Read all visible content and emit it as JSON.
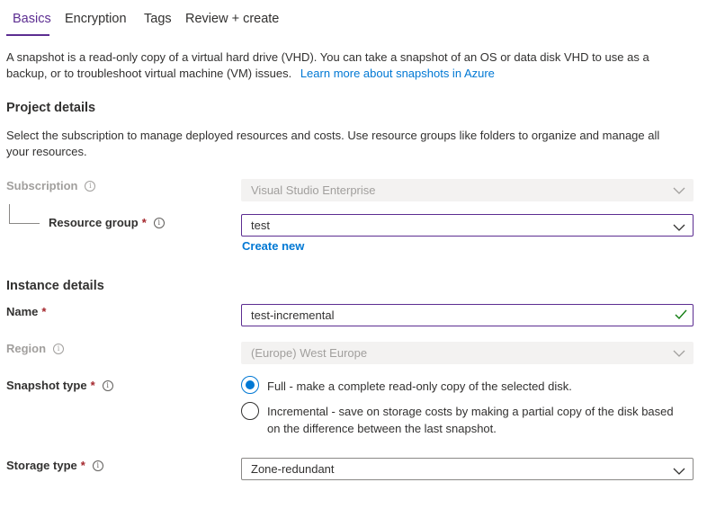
{
  "tabs": [
    {
      "label": "Basics",
      "active": true
    },
    {
      "label": "Encryption",
      "active": false
    },
    {
      "label": "Tags",
      "active": false
    },
    {
      "label": "Review + create",
      "active": false
    }
  ],
  "intro": {
    "line1": "A snapshot is a read-only copy of a virtual hard drive (VHD). You can take a snapshot of an OS or data disk VHD to use as a",
    "line2": "backup, or to troubleshoot virtual machine (VM) issues.",
    "link": "Learn more about snapshots in Azure"
  },
  "project_details": {
    "title": "Project details",
    "desc_line1": "Select the subscription to manage deployed resources and costs. Use resource groups like folders to organize and manage all",
    "desc_line2": "your resources.",
    "subscription": {
      "label": "Subscription",
      "value": "Visual Studio Enterprise",
      "disabled": true
    },
    "resource_group": {
      "label": "Resource group",
      "required_mark": "*",
      "value": "test",
      "create_new": "Create new"
    }
  },
  "instance_details": {
    "title": "Instance details",
    "name": {
      "label": "Name",
      "required_mark": "*",
      "value": "test-incremental",
      "valid": true
    },
    "region": {
      "label": "Region",
      "value": "(Europe) West Europe",
      "disabled": true
    },
    "snapshot_type": {
      "label": "Snapshot type",
      "required_mark": "*",
      "options": [
        {
          "line1": "Full - make a complete read-only copy of the selected disk.",
          "line2": "",
          "checked": true
        },
        {
          "line1": "Incremental - save on storage costs by making a partial copy of the disk based",
          "line2": "on the difference between the last snapshot.",
          "checked": false
        }
      ]
    },
    "storage_type": {
      "label": "Storage type",
      "required_mark": "*",
      "value": "Zone-redundant"
    }
  },
  "icons": {
    "info": "info-icon",
    "dropdown": "chevron-down-icon",
    "valid": "checkmark-icon"
  },
  "colors": {
    "accent": "#5c2d91",
    "link": "#0078d4",
    "required": "#a4262c",
    "valid": "#107c10",
    "disabled_text": "#a19f9d"
  }
}
